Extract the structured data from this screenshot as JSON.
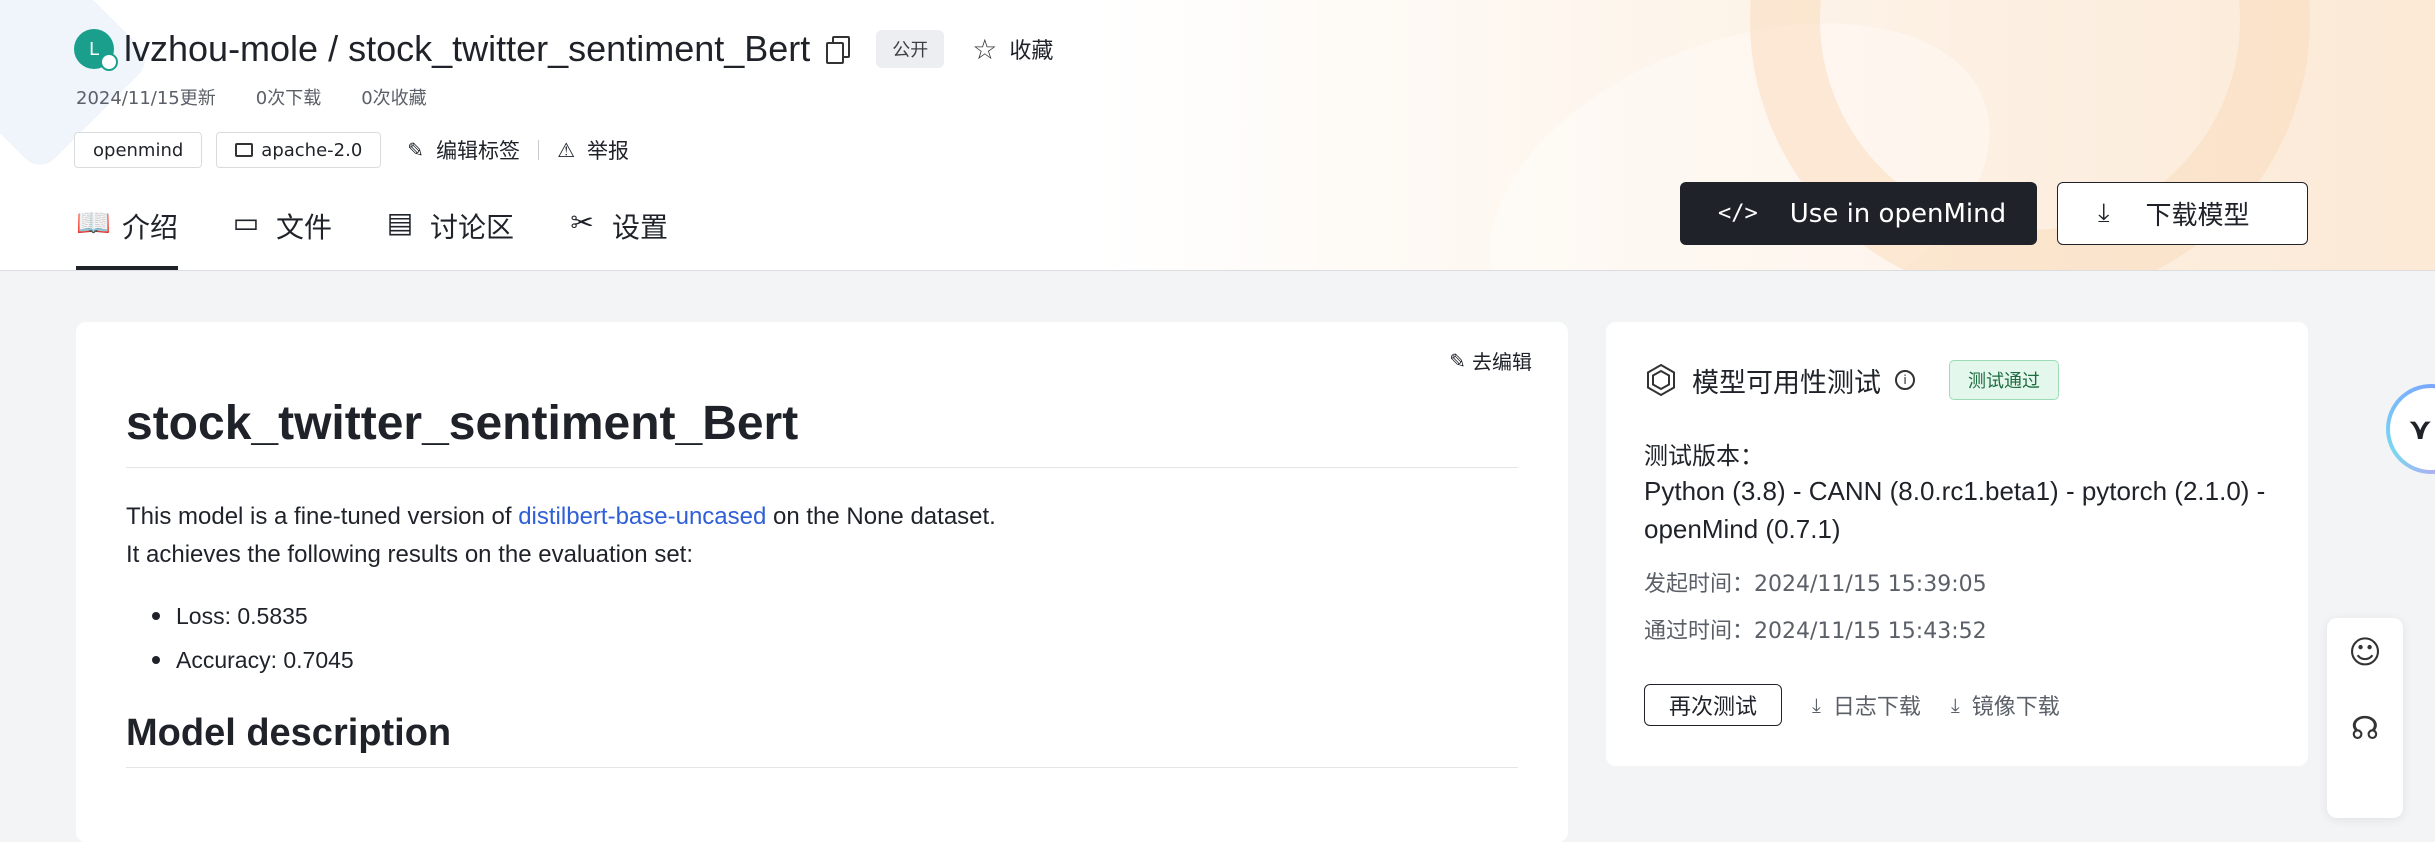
{
  "repo": {
    "avatar_letter": "L",
    "title": "lvzhou-mole / stock_twitter_sentiment_Bert",
    "visibility": "公开",
    "favorite_label": "收藏"
  },
  "meta": {
    "updated": "2024/11/15更新",
    "downloads": "0次下载",
    "favorites": "0次收藏"
  },
  "tags": {
    "items": [
      "openmind",
      "apache-2.0"
    ],
    "edit_label": "编辑标签",
    "report_label": "举报"
  },
  "tabs": [
    {
      "label": "介绍",
      "icon": "book-icon"
    },
    {
      "label": "文件",
      "icon": "terminal-icon"
    },
    {
      "label": "讨论区",
      "icon": "chat-icon"
    },
    {
      "label": "设置",
      "icon": "tools-icon"
    }
  ],
  "actions": {
    "use_openmind": "Use in openMind",
    "download_model": "下载模型"
  },
  "readme": {
    "edit_label": "去编辑",
    "h1": "stock_twitter_sentiment_Bert",
    "p1_before": "This model is a fine-tuned version of ",
    "p1_link": "distilbert-base-uncased",
    "p1_after": " on the None dataset.",
    "p2": "It achieves the following results on the evaluation set:",
    "results": [
      "Loss: 0.5835",
      "Accuracy: 0.7045"
    ],
    "h2": "Model description"
  },
  "test_panel": {
    "title": "模型可用性测试",
    "status": "测试通过",
    "version_label": "测试版本：",
    "version_value": "Python (3.8) - CANN (8.0.rc1.beta1) - pytorch (2.1.0) - openMind (0.7.1)",
    "start_label": "发起时间：",
    "start_value": "2024/11/15 15:39:05",
    "pass_label": "通过时间：",
    "pass_value": "2024/11/15 15:43:52",
    "retest_label": "再次测试",
    "log_download": "日志下载",
    "image_download": "镜像下载"
  },
  "colors": {
    "accent_dark": "#1f2329",
    "link": "#2f5fd8",
    "pass_bg": "#e4f7ec",
    "avatar": "#1a9f8d"
  }
}
